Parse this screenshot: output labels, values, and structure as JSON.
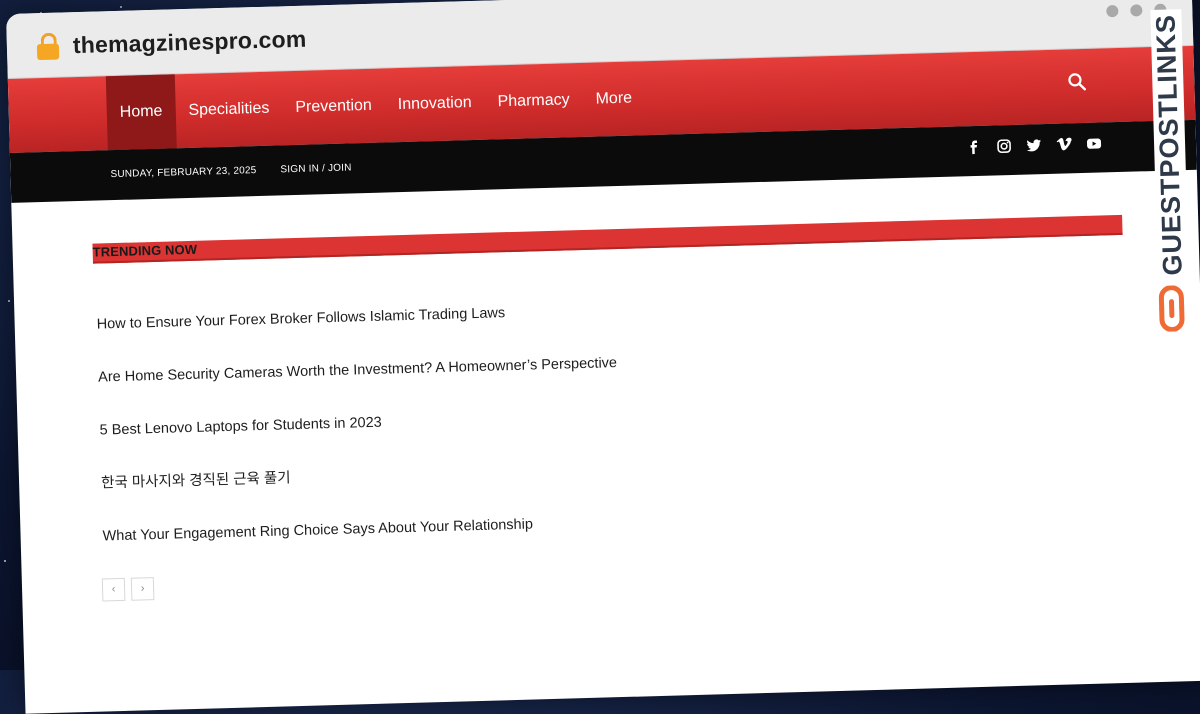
{
  "browser": {
    "url": "themagzinespro.com"
  },
  "nav": {
    "items": [
      "Home",
      "Specialities",
      "Prevention",
      "Innovation",
      "Pharmacy",
      "More"
    ],
    "active_index": 0
  },
  "topbar": {
    "date": "SUNDAY, FEBRUARY 23, 2025",
    "signin": "SIGN IN / JOIN",
    "socials": [
      "facebook-icon",
      "instagram-icon",
      "twitter-icon",
      "vimeo-icon",
      "youtube-icon"
    ]
  },
  "trending": {
    "label": "TRENDING NOW",
    "items": [
      "How to Ensure Your Forex Broker Follows Islamic Trading Laws",
      "Are Home Security Cameras Worth the Investment? A Homeowner’s Perspective",
      "5 Best Lenovo Laptops for Students in 2023",
      "한국 마사지와 경직된 근육 풀기",
      "What Your Engagement Ring Choice Says About Your Relationship"
    ],
    "prev": "‹",
    "next": "›"
  },
  "brand": {
    "text": "GUESTPOSTLINKS"
  },
  "colors": {
    "accent_red": "#dc3433",
    "active_nav": "#8f1919",
    "topbar_black": "#0b0b0b",
    "brand_orange": "#f06a35"
  }
}
